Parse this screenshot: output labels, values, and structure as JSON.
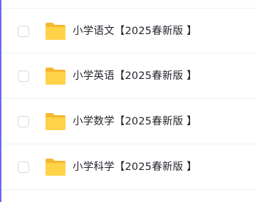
{
  "files": [
    {
      "name": "小学语文【2025春新版 】",
      "icon": "folder-icon"
    },
    {
      "name": "小学英语【2025春新版 】",
      "icon": "folder-icon"
    },
    {
      "name": "小学数学【2025春新版 】",
      "icon": "folder-icon"
    },
    {
      "name": "小学科学【2025春新版 】",
      "icon": "folder-icon"
    }
  ],
  "colors": {
    "folder_back": "#f5b82e",
    "folder_front": "#ffd247",
    "row_divider": "#edf0f4",
    "accent_border": "#6b63ff",
    "text": "#1f2329"
  }
}
